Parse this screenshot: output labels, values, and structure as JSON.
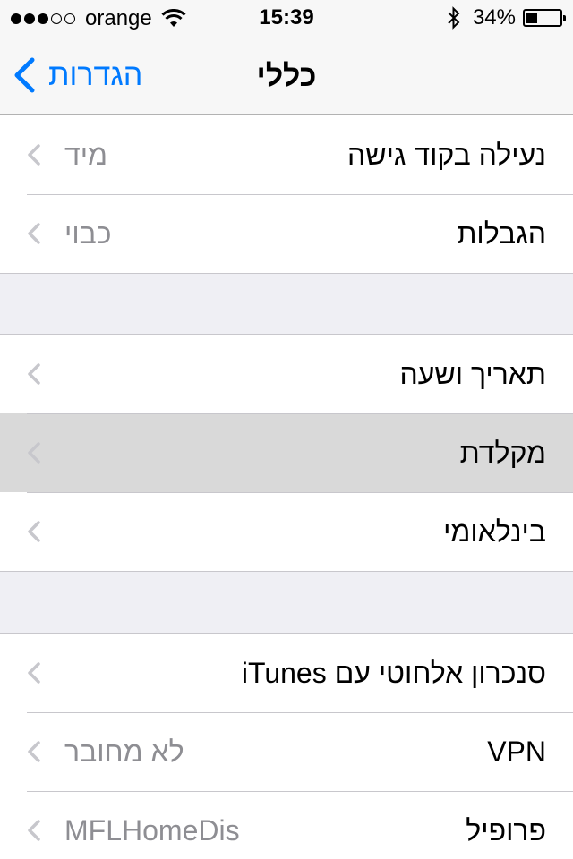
{
  "status_bar": {
    "carrier": "orange",
    "signal_bars_filled": 3,
    "signal_bars_total": 5,
    "time": "15:39",
    "battery_percent_label": "34%",
    "battery_level": 0.34
  },
  "nav": {
    "title": "כללי",
    "back_label": "הגדרות"
  },
  "groups": [
    {
      "rows": [
        {
          "label": "נעילה בקוד גישה",
          "value": "מיד"
        },
        {
          "label": "הגבלות",
          "value": "כבוי"
        }
      ]
    },
    {
      "rows": [
        {
          "label": "תאריך ושעה",
          "value": ""
        },
        {
          "label": "מקלדת",
          "value": "",
          "highlighted": true
        },
        {
          "label": "בינלאומי",
          "value": ""
        }
      ]
    },
    {
      "rows": [
        {
          "label": "סנכרון אלחוטי עם iTunes",
          "value": ""
        },
        {
          "label": "VPN",
          "value": "לא מחובר"
        },
        {
          "label": "פרופיל",
          "value": "MFLHomeDis"
        }
      ]
    }
  ],
  "colors": {
    "accent": "#007aff",
    "background": "#efeff4",
    "separator": "#c8c7cc",
    "value_text": "#8e8e93",
    "highlight": "#d9d9d9",
    "chevron": "#c7c7cc"
  },
  "icons": {
    "wifi": "wifi-icon",
    "bluetooth": "bluetooth-icon",
    "battery": "battery-icon",
    "back": "chevron-left-icon",
    "row_disclosure": "chevron-icon"
  }
}
